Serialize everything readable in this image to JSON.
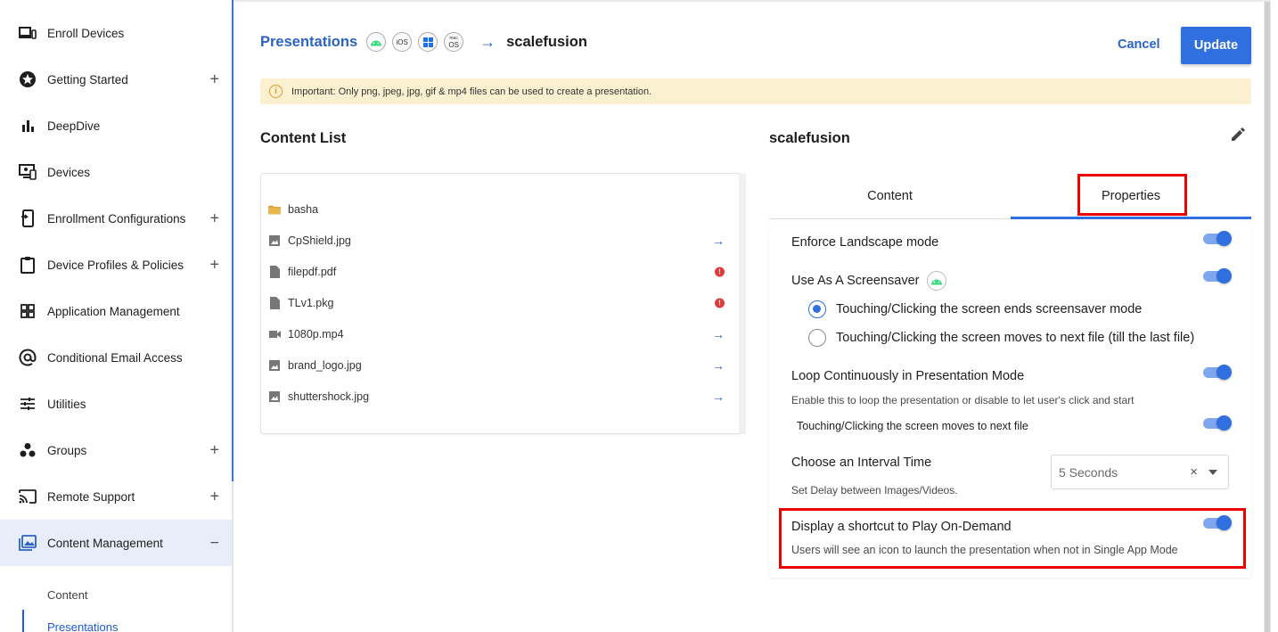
{
  "sidebar": {
    "items": [
      {
        "label": "Enroll Devices",
        "icon": "enroll-devices-icon",
        "expandable": false
      },
      {
        "label": "Getting Started",
        "icon": "star-icon",
        "expandable": true
      },
      {
        "label": "DeepDive",
        "icon": "bar-chart-icon",
        "expandable": false
      },
      {
        "label": "Devices",
        "icon": "devices-icon",
        "expandable": false
      },
      {
        "label": "Enrollment Configurations",
        "icon": "enrollment-config-icon",
        "expandable": true
      },
      {
        "label": "Device Profiles & Policies",
        "icon": "clipboard-icon",
        "expandable": true
      },
      {
        "label": "Application Management",
        "icon": "grid-icon",
        "expandable": false
      },
      {
        "label": "Conditional Email Access",
        "icon": "at-icon",
        "expandable": false
      },
      {
        "label": "Utilities",
        "icon": "sliders-icon",
        "expandable": false
      },
      {
        "label": "Groups",
        "icon": "groups-icon",
        "expandable": true
      },
      {
        "label": "Remote Support",
        "icon": "cast-icon",
        "expandable": true
      },
      {
        "label": "Content Management",
        "icon": "image-library-icon",
        "expandable": true,
        "expanded": true
      }
    ],
    "plus_symbol": "+",
    "minus_symbol": "−",
    "sub_items": [
      "Content",
      "Presentations"
    ]
  },
  "header": {
    "breadcrumb_link": "Presentations",
    "os_badges": [
      "android",
      "iOS",
      "windows",
      "macOS"
    ],
    "ios_text": "iOS",
    "macos_top": "mac",
    "macos_bottom": "OS",
    "arrow": "→",
    "current": "scalefusion",
    "cancel_label": "Cancel",
    "update_label": "Update"
  },
  "notice": {
    "icon_glyph": "i",
    "text": "Important: Only png, jpeg, jpg, gif & mp4 files can be used to create a presentation."
  },
  "content_list": {
    "title": "Content List",
    "items": [
      {
        "name": "basha",
        "type": "folder",
        "action": "none"
      },
      {
        "name": "CpShield.jpg",
        "type": "image",
        "action": "arrow"
      },
      {
        "name": "filepdf.pdf",
        "type": "document",
        "action": "error"
      },
      {
        "name": "TLv1.pkg",
        "type": "document",
        "action": "error"
      },
      {
        "name": "1080p.mp4",
        "type": "video",
        "action": "arrow"
      },
      {
        "name": "brand_logo.jpg",
        "type": "image",
        "action": "arrow"
      },
      {
        "name": "shuttershock.jpg",
        "type": "image",
        "action": "arrow"
      }
    ],
    "arrow_glyph": "→",
    "error_glyph": "!"
  },
  "presentation": {
    "name": "scalefusion",
    "tabs": [
      "Content",
      "Properties"
    ],
    "active_tab": "Properties",
    "properties": {
      "enforce_landscape": {
        "label": "Enforce Landscape mode",
        "enabled": true
      },
      "screensaver": {
        "label": "Use As A Screensaver",
        "enabled": true,
        "options": [
          {
            "label": "Touching/Clicking the screen ends screensaver mode",
            "selected": true
          },
          {
            "label": "Touching/Clicking the screen moves to next file (till the last file)",
            "selected": false
          }
        ]
      },
      "loop": {
        "label": "Loop Continuously in Presentation Mode",
        "description": "Enable this to loop the presentation or disable to let user's click and start",
        "enabled": true
      },
      "touch_next": {
        "label": "Touching/Clicking the screen moves to next file",
        "enabled": true
      },
      "interval": {
        "label": "Choose an Interval Time",
        "description": "Set Delay between Images/Videos.",
        "value": "5 Seconds",
        "clear_glyph": "×"
      },
      "shortcut": {
        "label": "Display a shortcut to Play On-Demand",
        "description": "Users will see an icon to launch the presentation when not in Single App Mode",
        "enabled": true
      }
    }
  },
  "colors": {
    "accent": "#2f6fe0",
    "link": "#2b63c4",
    "highlight": "#ec0000",
    "notice_bg": "#fbf0cf",
    "android_green": "#3ddc84",
    "folder": "#d9a640",
    "error": "#e03a3a"
  }
}
